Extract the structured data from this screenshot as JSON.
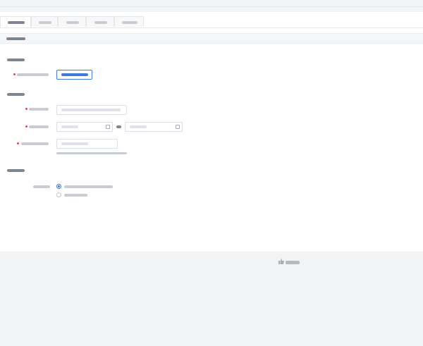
{
  "tabs": [
    {
      "label": "",
      "active": true
    },
    {
      "label": "",
      "active": false
    },
    {
      "label": "",
      "active": false
    },
    {
      "label": "",
      "active": false
    },
    {
      "label": "",
      "active": false
    }
  ],
  "panel_title": "",
  "sections": {
    "product": {
      "title": "",
      "field_label": "",
      "button_label": ""
    },
    "info": {
      "title": "",
      "name_label": "",
      "name_placeholder": "",
      "time_label": "",
      "start_placeholder": "",
      "to_label": "",
      "end_placeholder": "",
      "helpers_label": "",
      "helpers_placeholder": "",
      "helpers_hint": ""
    },
    "reward": {
      "title": "",
      "type_label": "",
      "options": [
        {
          "label": "",
          "selected": true
        },
        {
          "label": "",
          "selected": false
        }
      ]
    }
  },
  "footer_brand": "",
  "colors": {
    "accent": "#3f7bd8",
    "required": "#e24b4b",
    "page_bg": "#f2f3f5"
  }
}
